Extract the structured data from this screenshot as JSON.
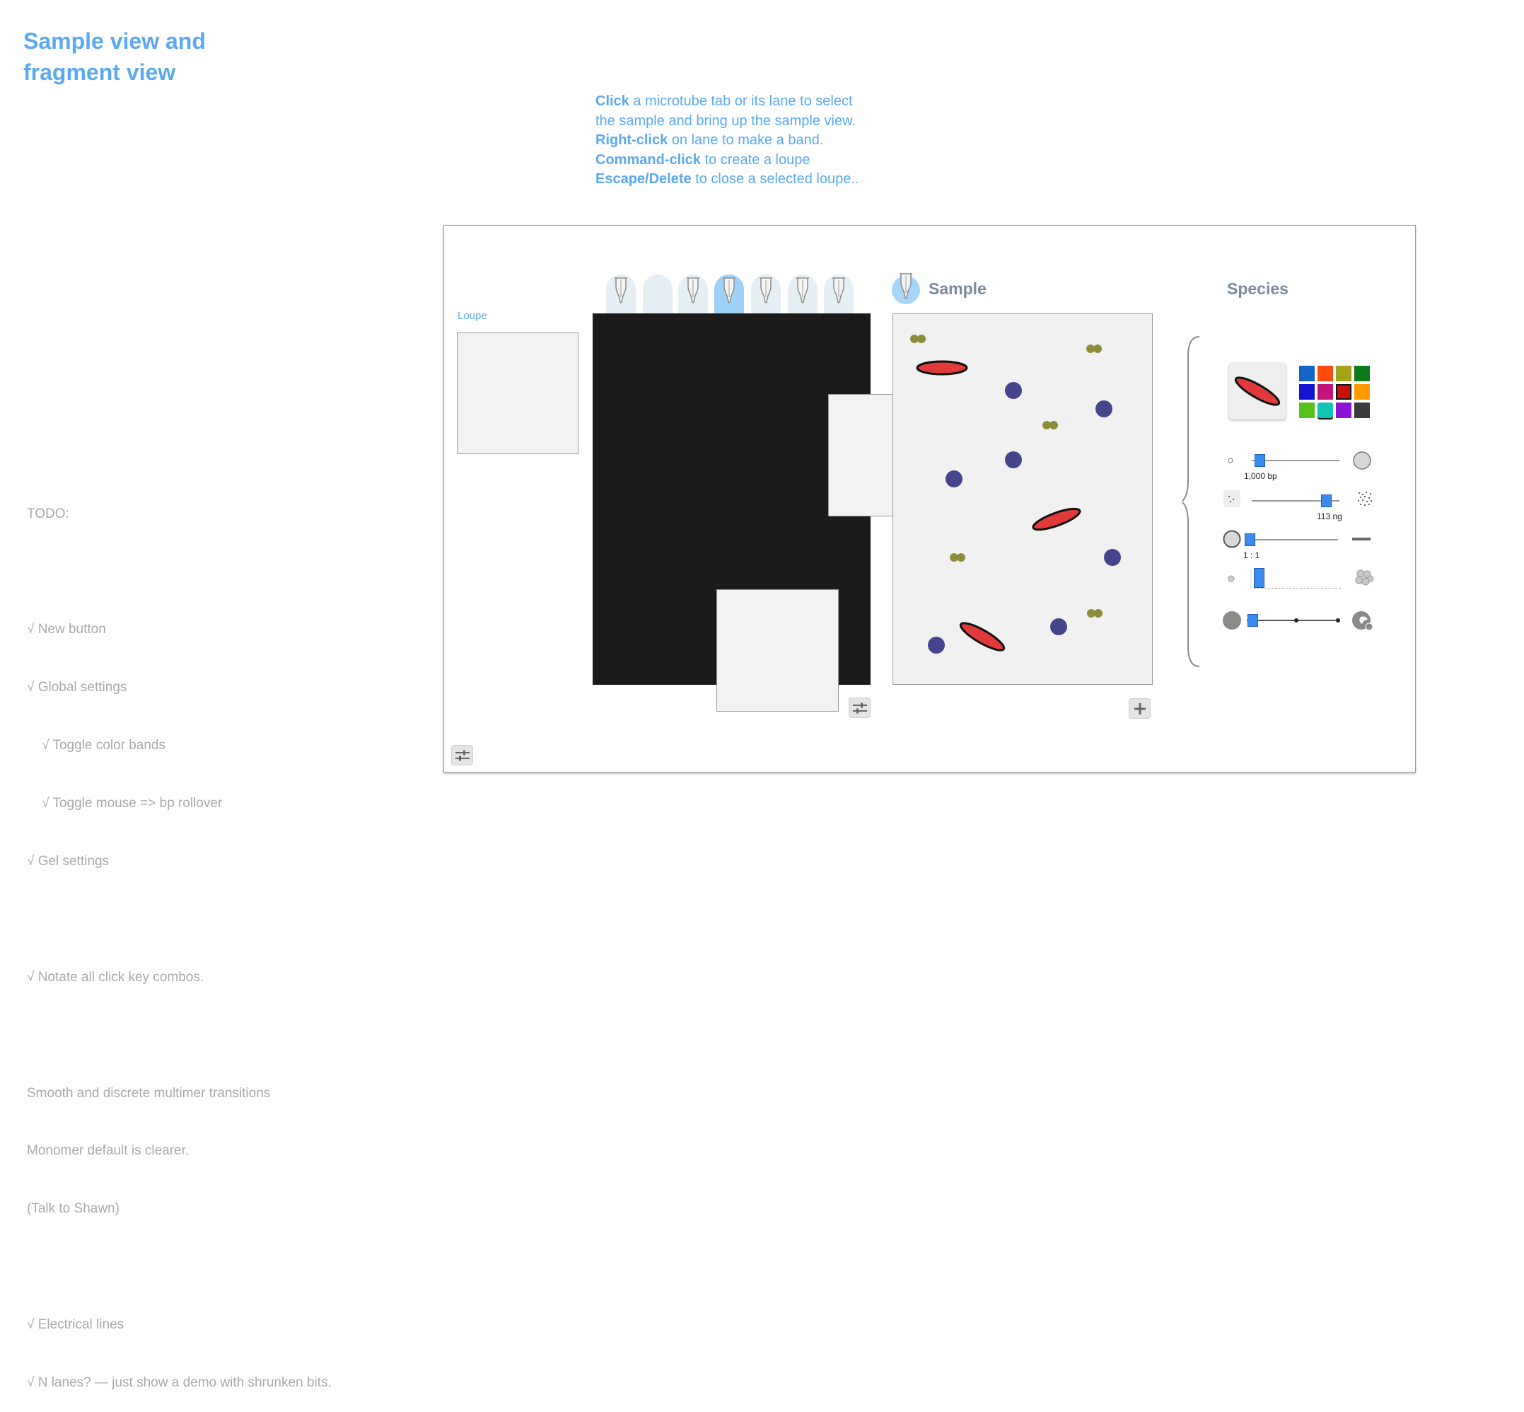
{
  "title": {
    "line1": "Sample view and",
    "line2": "fragment view"
  },
  "instructions": [
    {
      "key": "Click",
      "rest": " a microtube tab or its lane to select"
    },
    {
      "key": "",
      "rest": "the sample and bring up the sample view."
    },
    {
      "key": "Right-click",
      "rest": " on lane to make a band."
    },
    {
      "key": "Command-click",
      "rest": " to create a loupe"
    },
    {
      "key": "Escape/Delete",
      "rest": " to close a selected loupe.."
    }
  ],
  "todo": [
    "TODO:",
    "",
    "√ New button",
    "√ Global settings",
    "    √ Toggle color bands",
    "    √ Toggle mouse => bp rollover",
    "√ Gel settings",
    "",
    "√ Notate all click key combos.",
    "",
    "Smooth and discrete multimer transitions",
    "Monomer default is clearer.",
    "(Talk to Shawn)",
    "",
    "√ Electrical lines",
    "√ N lanes? — just show a demo with shrunken bits."
  ],
  "loupe": {
    "label": "Loupe"
  },
  "gel": {
    "tubes": [
      {
        "has_tube": true,
        "selected": false
      },
      {
        "has_tube": false,
        "selected": false
      },
      {
        "has_tube": true,
        "selected": false
      },
      {
        "has_tube": true,
        "selected": true
      },
      {
        "has_tube": true,
        "selected": false
      },
      {
        "has_tube": true,
        "selected": false
      },
      {
        "has_tube": true,
        "selected": false
      }
    ]
  },
  "sample": {
    "title": "Sample"
  },
  "species": {
    "title": "Species",
    "colors": [
      "#1565c8",
      "#ff4a10",
      "#a3a319",
      "#0f7a1a",
      "#1414d4",
      "#c2147a",
      "#cc1010",
      "#ff9a00",
      "#55c21a",
      "#12c2b4",
      "#8a12d4",
      "#3a3a3a"
    ],
    "selected_color": "#cc1010",
    "size_label": "1,000 bp",
    "amount_label": "113 ng",
    "ratio_label": "1 : 1",
    "size_value": 0.04,
    "amount_value": 0.9,
    "ratio_value": 0.0
  },
  "icons": {
    "gel_settings": "sliders-icon",
    "global_settings": "sliders-icon",
    "new_button": "plus-icon"
  }
}
